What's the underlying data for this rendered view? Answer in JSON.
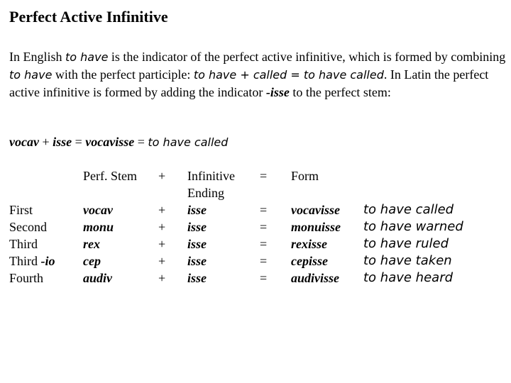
{
  "title": "Perfect Active Infinitive",
  "paragraph": {
    "p1": "In English ",
    "p1_it": "to have",
    "p2": " is the indicator of the perfect active infinitive, which is formed by combining ",
    "p2_it": "to have",
    "p3": " with the perfect participle: ",
    "p3_it": "to have + called = to have called",
    "p4": ". In Latin the perfect active infinitive is formed by adding the indicator ",
    "p4_bi": "-isse",
    "p5": " to the perfect stem:"
  },
  "example": {
    "stem": "vocav",
    "plus": " + ",
    "ending": "isse",
    "eq1": " = ",
    "form": "vocavisse",
    "eq2": " = ",
    "meaning": "to have called"
  },
  "table": {
    "headers": {
      "stem": "Perf. Stem",
      "plus": "+",
      "ending_line1": "Infinitive",
      "ending_line2": "Ending",
      "equals": "=",
      "form": "Form"
    },
    "rows": [
      {
        "conj": "First",
        "conj_suffix": "",
        "stem": "vocav",
        "plus": "+",
        "ending": "isse",
        "equals": "=",
        "form": "vocavisse",
        "meaning": "to have called"
      },
      {
        "conj": "Second",
        "conj_suffix": "",
        "stem": "monu",
        "plus": "+",
        "ending": "isse",
        "equals": "=",
        "form": "monuisse",
        "meaning": "to have warned"
      },
      {
        "conj": "Third",
        "conj_suffix": "",
        "stem": "rex",
        "plus": "+",
        "ending": "isse",
        "equals": "=",
        "form": "rexisse",
        "meaning": "to have ruled"
      },
      {
        "conj": "Third ",
        "conj_suffix": "-io",
        "stem": "cep",
        "plus": "+",
        "ending": "isse",
        "equals": "=",
        "form": "cepisse",
        "meaning": "to have taken"
      },
      {
        "conj": "Fourth",
        "conj_suffix": "",
        "stem": "audiv",
        "plus": "+",
        "ending": "isse",
        "equals": "=",
        "form": "audivisse",
        "meaning": "to have heard"
      }
    ]
  }
}
